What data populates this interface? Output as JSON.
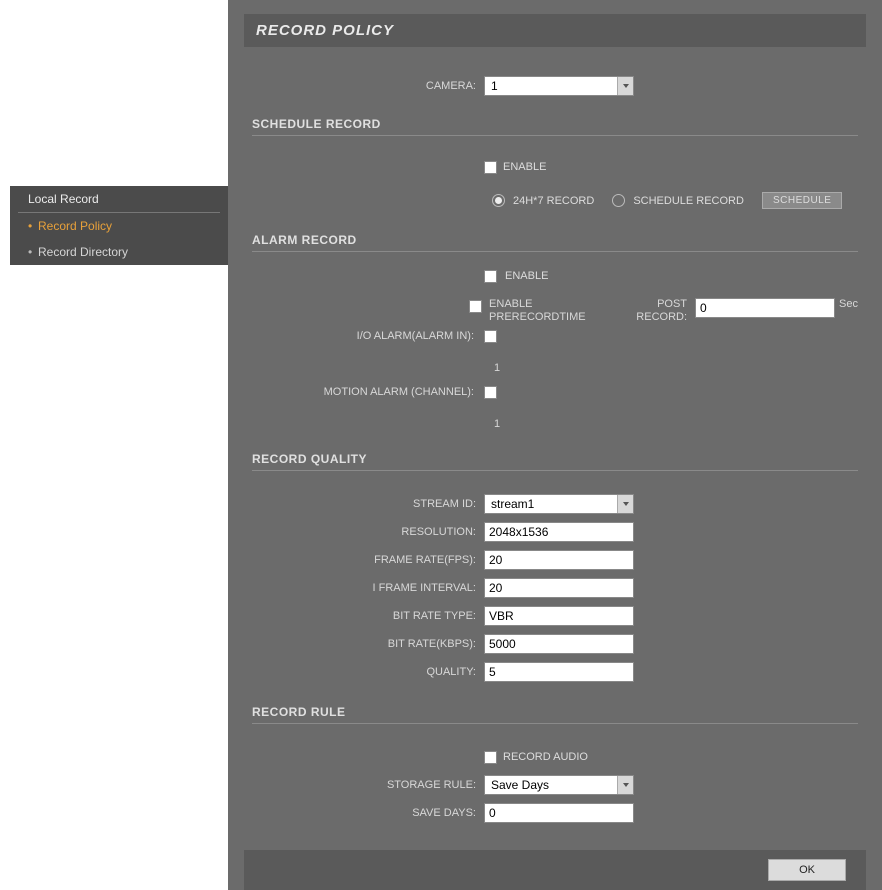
{
  "sidebar": {
    "title": "Local Record",
    "items": [
      {
        "label": "Record Policy"
      },
      {
        "label": "Record Directory"
      }
    ]
  },
  "page": {
    "title": "RECORD POLICY"
  },
  "camera": {
    "label": "CAMERA:",
    "value": "1"
  },
  "schedule_record": {
    "section": "SCHEDULE RECORD",
    "enable_label": "ENABLE",
    "opt1": "24H*7 RECORD",
    "opt2": "SCHEDULE RECORD",
    "btn": "SCHEDULE"
  },
  "alarm_record": {
    "section": "ALARM RECORD",
    "enable_label": "ENABLE",
    "prerecord_label": "ENABLE PRERECORDTIME",
    "postrecord_label": "POST RECORD:",
    "postrecord_value": "0",
    "sec": "Sec",
    "io_label": "I/O ALARM(ALARM IN):",
    "io_num": "1",
    "motion_label": "MOTION ALARM (CHANNEL):",
    "motion_num": "1"
  },
  "record_quality": {
    "section": "RECORD QUALITY",
    "stream_id_label": "STREAM ID:",
    "stream_id": "stream1",
    "resolution_label": "RESOLUTION:",
    "resolution": "2048x1536",
    "frame_rate_label": "FRAME RATE(FPS):",
    "frame_rate": "20",
    "i_frame_label": "I FRAME INTERVAL:",
    "i_frame": "20",
    "bit_rate_type_label": "BIT RATE TYPE:",
    "bit_rate_type": "VBR",
    "bit_rate_kbps_label": "BIT RATE(KBPS):",
    "bit_rate_kbps": "5000",
    "quality_label": "QUALITY:",
    "quality": "5"
  },
  "record_rule": {
    "section": "RECORD RULE",
    "record_audio_label": "RECORD AUDIO",
    "storage_rule_label": "STORAGE RULE:",
    "storage_rule": "Save Days",
    "save_days_label": "SAVE DAYS:",
    "save_days": "0"
  },
  "footer": {
    "ok": "OK"
  }
}
